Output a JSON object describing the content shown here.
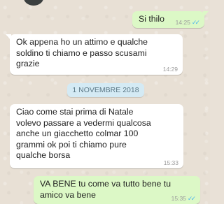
{
  "chat": {
    "messages": [
      {
        "direction": "out",
        "text": "Si thilo",
        "time": "14:25",
        "status": "read"
      },
      {
        "direction": "in",
        "text": "Ok appena ho un attimo e qualche\nsoldino ti chiamo e passo scusami\ngrazie",
        "time": "14:29"
      },
      {
        "direction": "in",
        "text": "Ciao come stai prima di Natale\nvolevo passare a vedermi qualcosa\nanche un giacchetto colmar 100\ngrammi ok poi ti chiamo pure\nqualche borsa",
        "time": "15:33"
      },
      {
        "direction": "out",
        "text": "VA BENE tu come va tutto bene tu\namico va bene",
        "time": "15:35",
        "status": "read"
      }
    ],
    "date_separator": "1 NOVEMBRE 2018",
    "colors": {
      "outgoing_bubble": "#dcf8c6",
      "incoming_bubble": "#ffffff",
      "date_chip": "#d4eaf4",
      "read_ticks": "#4fb6ec",
      "wallpaper": "#e8e0d5"
    },
    "icons": {
      "read_status": "double-check-icon"
    }
  }
}
